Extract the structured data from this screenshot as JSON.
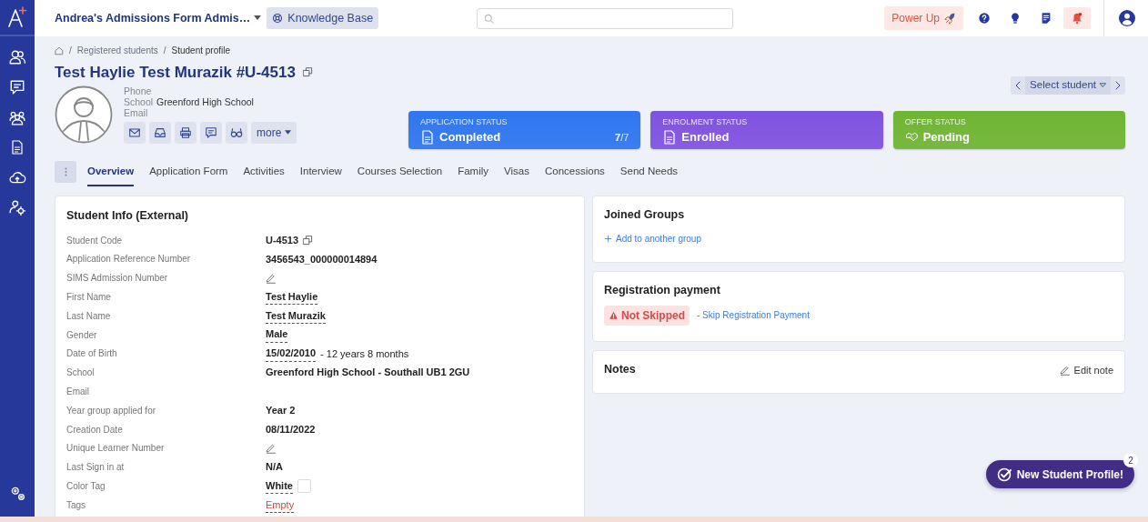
{
  "topbar": {
    "form_title": "Andrea's Admissions Form Admis…",
    "knowledge_base": "Knowledge Base",
    "power_up": "Power Up",
    "notifications_alert": true
  },
  "sidebar": {
    "items": [
      {
        "selected": false
      },
      {
        "selected": false
      },
      {
        "selected": false
      },
      {
        "selected": false
      },
      {
        "selected": false
      },
      {
        "selected": false
      }
    ]
  },
  "breadcrumb": {
    "separator": "/",
    "items": [
      "Registered students",
      "Student profile"
    ]
  },
  "profile": {
    "title": "Test Haylie Test Murazik #U-4513",
    "contacts": [
      {
        "label": "Phone"
      },
      {
        "label": "School",
        "value": "Greenford High School"
      },
      {
        "label": "Email"
      }
    ],
    "more": "more"
  },
  "select_student": "Select student",
  "status_cards": [
    {
      "title": "APPLICATION STATUS",
      "value": "Completed",
      "count": "7",
      "total": "/7",
      "color": "#2f76f0"
    },
    {
      "title": "ENROLMENT STATUS",
      "value": "Enrolled",
      "color": "#8052e0"
    },
    {
      "title": "OFFER STATUS",
      "value": "Pending",
      "color": "#6fb533"
    }
  ],
  "tabs": [
    {
      "label": "Overview",
      "selected": true
    },
    {
      "label": "Application Form",
      "selected": false
    },
    {
      "label": "Activities",
      "selected": false
    },
    {
      "label": "Interview",
      "selected": false
    },
    {
      "label": "Courses Selection",
      "selected": false
    },
    {
      "label": "Family",
      "selected": false
    },
    {
      "label": "Visas",
      "selected": false
    },
    {
      "label": "Concessions",
      "selected": false
    },
    {
      "label": "Send Needs",
      "selected": false
    }
  ],
  "student_info": {
    "title": "Student Info (External)",
    "rows": [
      {
        "label": "Student Code",
        "kind": "copy",
        "value": "U-4513"
      },
      {
        "label": "Application Reference Number",
        "kind": "text",
        "value": "3456543_000000014894"
      },
      {
        "label": "SIMS Admission Number",
        "kind": "edit"
      },
      {
        "label": "First Name",
        "kind": "dotted",
        "value": "Test Haylie"
      },
      {
        "label": "Last Name",
        "kind": "dotted",
        "value": "Test Murazik"
      },
      {
        "label": "Gender",
        "kind": "dotted",
        "value": "Male"
      },
      {
        "label": "Date of Birth",
        "kind": "dotted",
        "value": "15/02/2010",
        "suffix": "- 12 years 8 months"
      },
      {
        "label": "School",
        "kind": "text",
        "value": "Greenford High School - Southall UB1 2GU"
      },
      {
        "label": "Email",
        "kind": "blank"
      },
      {
        "label": "Year group applied for",
        "kind": "text",
        "value": "Year 2"
      },
      {
        "label": "Creation Date",
        "kind": "text",
        "value": "08/11/2022"
      },
      {
        "label": "Unique Learner Number",
        "kind": "edit"
      },
      {
        "label": "Last Sign in at",
        "kind": "text",
        "value": "N/A"
      },
      {
        "label": "Color Tag",
        "kind": "color",
        "value": "White",
        "color": "#ffffff"
      },
      {
        "label": "Tags",
        "kind": "empty",
        "value": "Empty"
      }
    ]
  },
  "joined_groups": {
    "title": "Joined Groups",
    "add_link": "Add to another group"
  },
  "registration_payment": {
    "title": "Registration payment",
    "status": "Not Skipped",
    "link": "- Skip Registration Payment"
  },
  "notes": {
    "title": "Notes",
    "edit": "Edit note"
  },
  "promo": {
    "label": "New Student Profile!",
    "count": "2"
  }
}
